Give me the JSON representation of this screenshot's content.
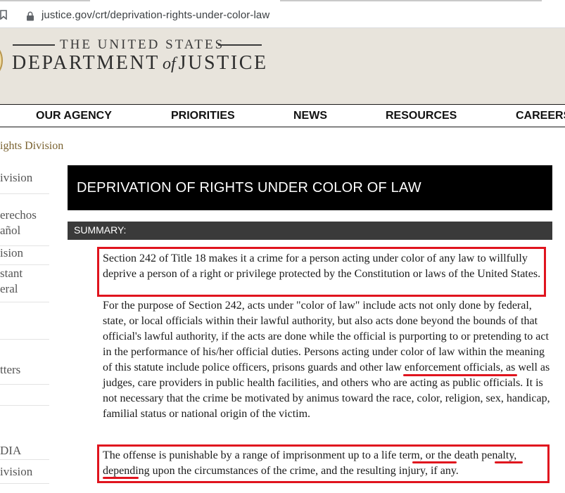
{
  "browser": {
    "url": "justice.gov/crt/deprivation-rights-under-color-law"
  },
  "header": {
    "logo_top": "THE UNITED STATES",
    "logo_department": "DEPARTMENT",
    "logo_of": "of",
    "logo_justice": "JUSTICE"
  },
  "nav": {
    "items": [
      {
        "label": "OUR AGENCY"
      },
      {
        "label": "PRIORITIES"
      },
      {
        "label": "NEWS"
      },
      {
        "label": "RESOURCES"
      },
      {
        "label": "CAREERS"
      }
    ]
  },
  "breadcrumb": "ights Division",
  "sidebar": {
    "items": [
      {
        "line1": "ivision",
        "line2": ""
      },
      {
        "line1": "erechos",
        "line2": "añol"
      },
      {
        "line1": "ision",
        "line2": ""
      },
      {
        "line1": "stant",
        "line2": "eral"
      },
      {
        "line1": "",
        "line2": ""
      },
      {
        "line1": "tters",
        "line2": ""
      },
      {
        "line1": "",
        "line2": ""
      },
      {
        "line1": "DIA",
        "line2": ""
      },
      {
        "line1": "ivision",
        "line2": ""
      }
    ]
  },
  "main": {
    "title": "DEPRIVATION OF RIGHTS UNDER COLOR OF LAW",
    "summary_label": "SUMMARY:",
    "paragraph1": "Section 242 of Title 18 makes it a crime for a person acting under color of any law to willfully deprive a person of a right or privilege protected by the Constitution or laws of the United States.",
    "paragraph2": "For the purpose of Section 242, acts under \"color of law\" include acts not only done by federal, state, or local officials within their lawful authority, but also acts done beyond the bounds of that official's lawful authority, if the acts are done while the official is purporting to or pretending to act in the performance of his/her official duties. Persons acting under color of law within the meaning of this statute include police officers, prisons guards and other law enforcement officials, as well as judges, care providers in public health facilities, and others who are acting as public officials. It is not necessary that the crime be motivated by animus toward the race, color, religion, sex, handicap, familial status or national origin of the victim.",
    "paragraph3": "The offense is punishable by a range of imprisonment up to a life term, or the death penalty, depending upon the circumstances of the crime, and the resulting injury, if any."
  },
  "colors": {
    "header_bg": "#e8e4dc",
    "annotation_red": "#e0141e",
    "breadcrumb": "#7a6230"
  }
}
